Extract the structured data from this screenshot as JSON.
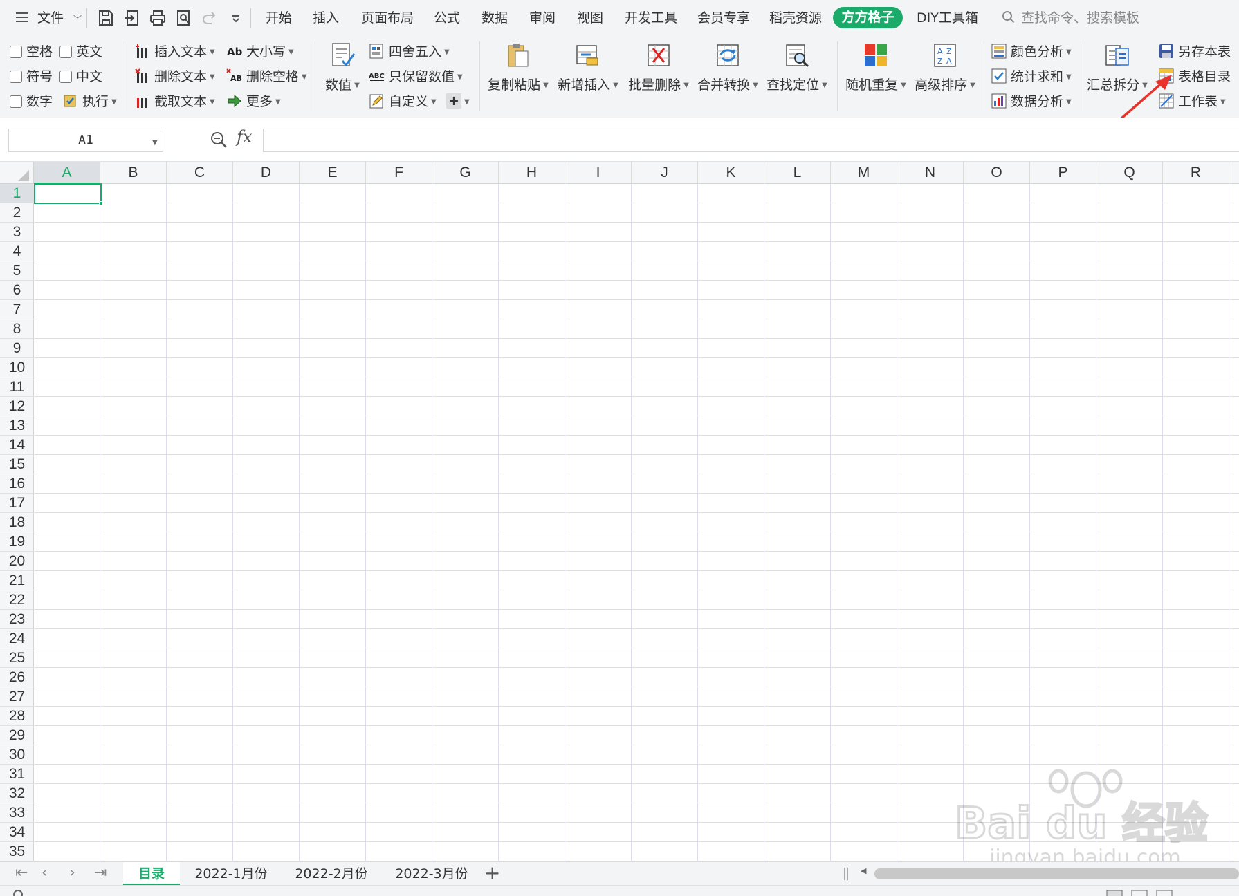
{
  "menubar": {
    "file_label": "文件",
    "tabs": [
      "开始",
      "插入",
      "页面布局",
      "公式",
      "数据",
      "审阅",
      "视图",
      "开发工具",
      "会员专享",
      "稻壳资源",
      "方方格子",
      "DIY工具箱"
    ],
    "active_tab": "方方格子",
    "search_placeholder": "查找命令、搜索模板"
  },
  "ribbon": {
    "checkboxes": [
      "空格",
      "英文",
      "符号",
      "中文",
      "数字"
    ],
    "execute": "执行",
    "text_tools": [
      "插入文本",
      "删除文本",
      "截取文本"
    ],
    "case_tools": [
      "大小写",
      "删除空格",
      "更多"
    ],
    "numeric": "数值",
    "round_tools": [
      "四舍五入",
      "只保留数值",
      "自定义"
    ],
    "big_buttons": [
      "复制粘贴",
      "新增插入",
      "批量删除",
      "合并转换",
      "查找定位",
      "随机重复",
      "高级排序"
    ],
    "analysis_tools": [
      "颜色分析",
      "统计求和",
      "数据分析"
    ],
    "summary_split": "汇总拆分",
    "workbook_tools": [
      "另存本表",
      "表格目录",
      "工作表"
    ]
  },
  "formula_bar": {
    "cell_ref": "A1",
    "fx": "fx",
    "formula": ""
  },
  "grid": {
    "columns": [
      "A",
      "B",
      "C",
      "D",
      "E",
      "F",
      "G",
      "H",
      "I",
      "J",
      "K",
      "L",
      "M",
      "N",
      "O",
      "P",
      "Q",
      "R"
    ],
    "row_count": 35,
    "selected_column": "A",
    "selected_row": 1
  },
  "sheets": {
    "tabs": [
      "目录",
      "2022-1月份",
      "2022-2月份",
      "2022-3月份"
    ],
    "active": "目录"
  },
  "colors": {
    "accent": "#1aaa6a",
    "annotation_arrow": "#e8322a"
  },
  "watermark": {
    "brand": "Bai du 经验",
    "url": "jingyan.baidu.com"
  }
}
